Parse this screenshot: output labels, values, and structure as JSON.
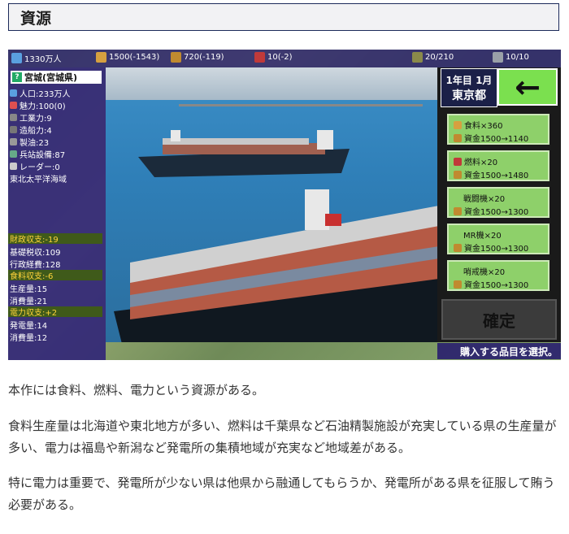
{
  "section": {
    "title": "資源"
  },
  "topbar": {
    "population": "1330万人",
    "food": "1500(-1543)",
    "funds": "720(-119)",
    "fuel": "10(-2)",
    "prefs": "20/210",
    "turn": "10/10"
  },
  "prefecture": {
    "name": "宮城(宮城県)",
    "stats": [
      "人口:233万人",
      "魅力:100(0)",
      "工業力:9",
      "造船力:4",
      "製油:23",
      "兵站設備:87",
      "レーダー:0",
      "東北太平洋海域"
    ],
    "finance": {
      "label": "財政収支:-19",
      "items": [
        "基礎税収:109",
        "行政経費:128"
      ]
    },
    "food": {
      "label": "食料収支:-6",
      "items": [
        "生産量:15",
        "消費量:21"
      ]
    },
    "power": {
      "label": "電力収支:+2",
      "items": [
        "発電量:14",
        "消費量:12"
      ]
    }
  },
  "date": {
    "line1": "1年目 1月",
    "line2": "東京都"
  },
  "purchase_items": [
    {
      "name": "食料×360",
      "cost": "資金1500→1140"
    },
    {
      "name": "燃料×20",
      "cost": "資金1500→1480"
    },
    {
      "name": "戦闘機×20",
      "cost": "資金1500→1300"
    },
    {
      "name": "MR機×20",
      "cost": "資金1500→1300"
    },
    {
      "name": "哨戒機×20",
      "cost": "資金1500→1300"
    }
  ],
  "confirm_label": "確定",
  "hint": "購入する品目を選択。",
  "paragraphs": [
    "本作には食料、燃料、電力という資源がある。",
    "食料生産量は北海道や東北地方が多い、燃料は千葉県など石油精製施設が充実している県の生産量が多い、電力は福島や新潟など発電所の集積地域が充実など地域差がある。",
    "特に電力は重要で、発電所が少ない県は他県から融通してもらうか、発電所がある県を征服して賄う必要がある。"
  ]
}
